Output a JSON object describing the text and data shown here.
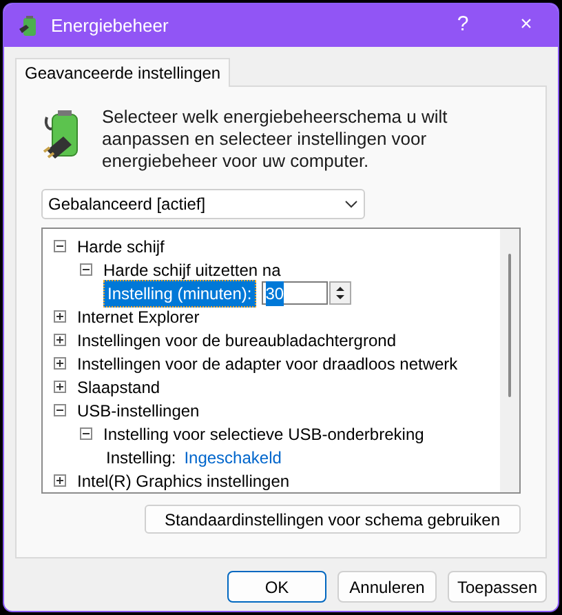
{
  "window": {
    "title": "Energiebeheer",
    "buttons": [
      "?",
      "×"
    ]
  },
  "tabs": [
    {
      "label": "Geavanceerde instellingen",
      "selected": true
    }
  ],
  "description": "Selecteer welk energiebeheerschema u wilt aanpassen en selecteer instellingen voor energiebeheer voor uw computer.",
  "plan_dropdown": {
    "value": "Gebalanceerd [actief]"
  },
  "tree": [
    {
      "label": "Harde schijf",
      "expanded": true,
      "children": [
        {
          "label": "Harde schijf uitzetten na",
          "expanded": true,
          "children": [
            {
              "kind": "spin",
              "label": "Instelling (minuten):",
              "value": "30",
              "selected": true
            }
          ]
        }
      ]
    },
    {
      "label": "Internet Explorer",
      "expanded": false
    },
    {
      "label": "Instellingen voor de bureaubladachtergrond",
      "expanded": false
    },
    {
      "label": "Instellingen voor de adapter voor draadloos netwerk",
      "expanded": false
    },
    {
      "label": "Slaapstand",
      "expanded": false
    },
    {
      "label": "USB-instellingen",
      "expanded": true,
      "children": [
        {
          "label": "Instelling voor selectieve USB-onderbreking",
          "expanded": true,
          "children": [
            {
              "kind": "link",
              "label": "Instelling:",
              "value": "Ingeschakeld",
              "selected": false
            }
          ]
        }
      ]
    },
    {
      "label": "Intel(R) Graphics instellingen",
      "expanded": false
    }
  ],
  "restore_button": "Standaardinstellingen voor schema gebruiken",
  "dialog_buttons": [
    {
      "label": "OK",
      "default": true
    },
    {
      "label": "Annuleren",
      "default": false
    },
    {
      "label": "Toepassen",
      "default": false
    }
  ]
}
